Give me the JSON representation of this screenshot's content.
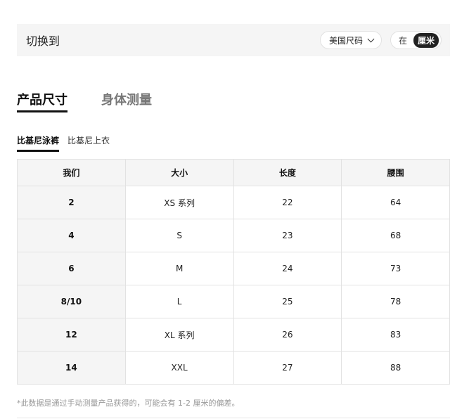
{
  "switch_bar": {
    "label": "切换到",
    "region_select": "美国尺码",
    "unit_options": [
      "在",
      "厘米"
    ],
    "active_unit": "厘米"
  },
  "tabs": [
    {
      "label": "产品尺寸",
      "active": true
    },
    {
      "label": "身体测量",
      "active": false
    }
  ],
  "subtabs": [
    {
      "label": "比基尼泳裤",
      "active": true
    },
    {
      "label": "比基尼上衣",
      "active": false
    }
  ],
  "table": {
    "headers": [
      "我们",
      "大小",
      "长度",
      "腰围"
    ],
    "rows": [
      [
        "2",
        "XS 系列",
        "22",
        "64"
      ],
      [
        "4",
        "S",
        "23",
        "68"
      ],
      [
        "6",
        "M",
        "24",
        "73"
      ],
      [
        "8/10",
        "L",
        "25",
        "78"
      ],
      [
        "12",
        "XL 系列",
        "26",
        "83"
      ],
      [
        "14",
        "XXL",
        "27",
        "88"
      ]
    ]
  },
  "note": "*此数据是通过手动测量产品获得的，可能会有 1-2 厘米的偏差。"
}
